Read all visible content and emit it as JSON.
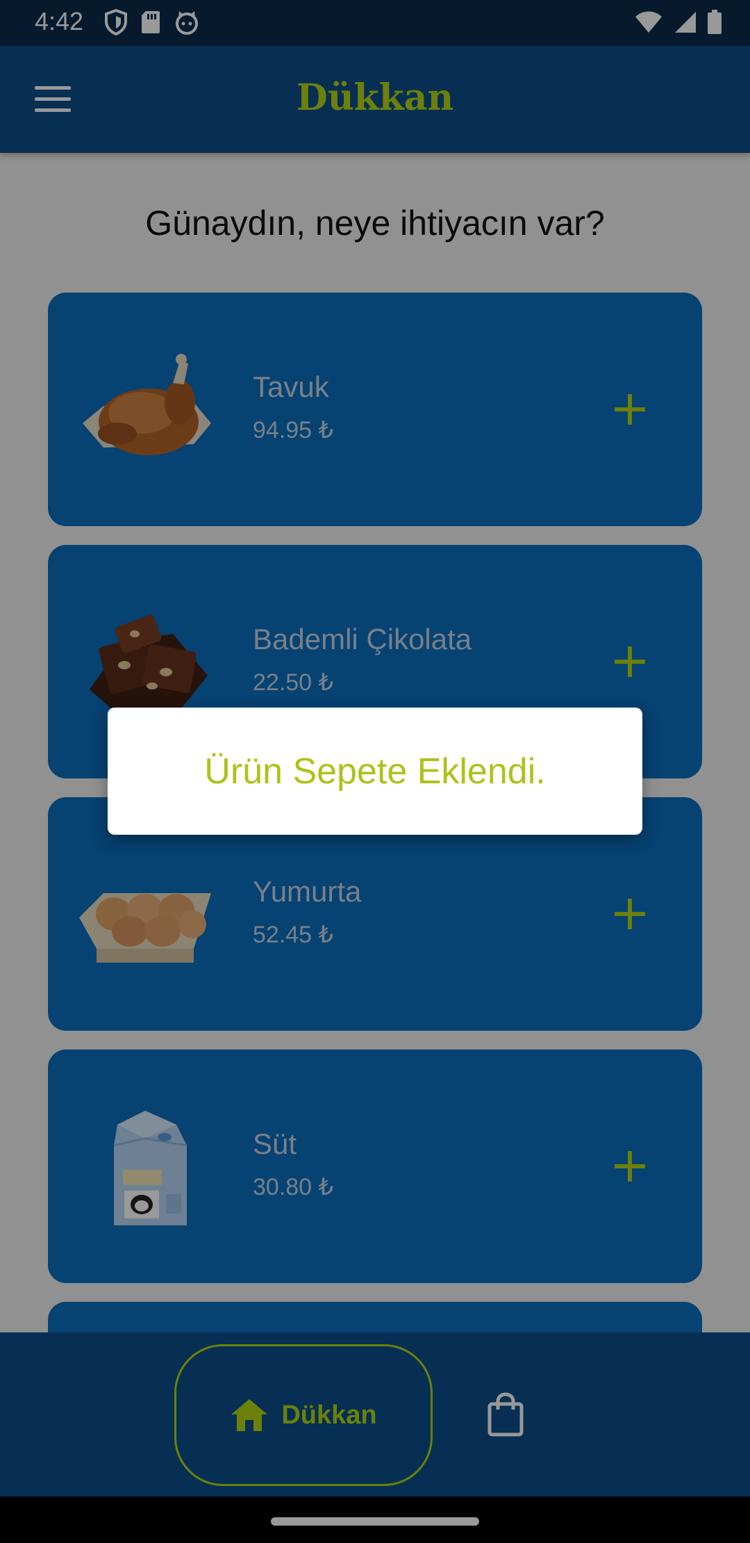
{
  "status_bar": {
    "time": "4:42"
  },
  "app_bar": {
    "title": "Dükkan"
  },
  "greeting": "Günaydın, neye ihtiyacın var?",
  "products": [
    {
      "name": "Tavuk",
      "price": "94.95 ₺",
      "icon": "roast-chicken-image"
    },
    {
      "name": "Bademli Çikolata",
      "price": "22.50 ₺",
      "icon": "almond-chocolate-image"
    },
    {
      "name": "Yumurta",
      "price": "52.45 ₺",
      "icon": "egg-carton-image"
    },
    {
      "name": "Süt",
      "price": "30.80 ₺",
      "icon": "milk-carton-image"
    }
  ],
  "bottom_nav": {
    "shop_label": "Dükkan",
    "shop_icon": "home-icon",
    "cart_icon": "shopping-bag-icon"
  },
  "dialog": {
    "message": "Ürün Sepete Eklendi."
  },
  "colors": {
    "accent": "#b4d613",
    "card": "#0b6fbe",
    "app_bar": "#0b4f8a",
    "status_bar": "#0a2a4b"
  }
}
